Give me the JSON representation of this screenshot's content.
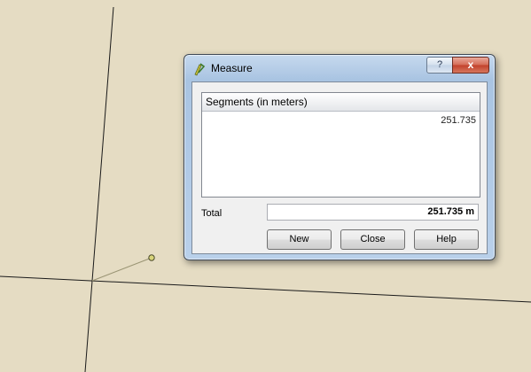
{
  "dialog": {
    "title": "Measure",
    "help_button": "?",
    "close_button": "x",
    "table_header": "Segments (in meters)",
    "segments": [
      "251.735"
    ],
    "total_label": "Total",
    "total_value": "251.735 m",
    "buttons": {
      "new": "New",
      "close": "Close",
      "help": "Help"
    }
  },
  "colors": {
    "map_background": "#e5dcc3",
    "measure_line": "#9a9474",
    "vertex_fill": "#d8d47a"
  }
}
